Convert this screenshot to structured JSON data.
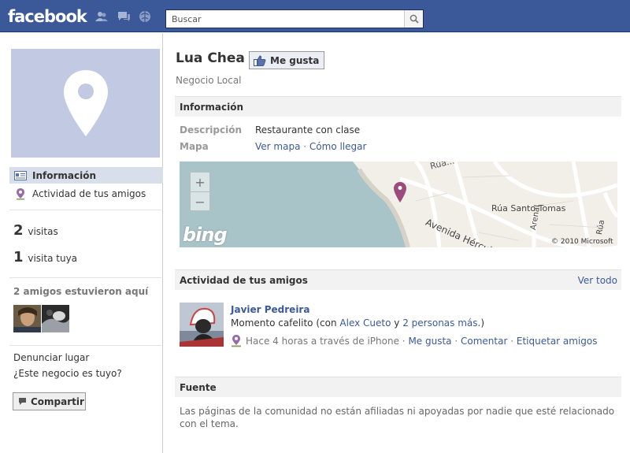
{
  "topbar": {
    "logo": "facebook",
    "search_placeholder": "Buscar",
    "jewels": [
      "friends-icon",
      "messages-icon",
      "notifications-icon"
    ]
  },
  "sidebar": {
    "nav": [
      {
        "label": "Información",
        "icon": "info-card-icon",
        "selected": true
      },
      {
        "label": "Actividad de tus amigos",
        "icon": "place-pin-icon",
        "selected": false
      }
    ],
    "stats": [
      {
        "number": "2",
        "label": "visitas"
      },
      {
        "number": "1",
        "label": "visita tuya"
      }
    ],
    "friends_title": "2 amigos estuvieron aquí",
    "links": [
      "Denunciar lugar",
      "¿Este negocio es tuyo?"
    ],
    "share_label": "Compartir"
  },
  "page": {
    "title": "Lua Chea",
    "like_label": "Me gusta",
    "category": "Negocio Local"
  },
  "info": {
    "header": "Información",
    "desc_label": "Descripción",
    "desc_value": "Restaurante con clase",
    "map_label": "Mapa",
    "map_link": "Ver mapa",
    "map_sep": "·",
    "directions_link": "Cómo llegar",
    "map_streets": [
      "Rúa...",
      "Avenida Hércules",
      "Rúa Santo Tomas",
      "Arenal",
      "Rúa"
    ],
    "map_logo": "bing",
    "map_copyright": "© 2010 Microsoft"
  },
  "activity": {
    "header": "Actividad de tus amigos",
    "see_all": "Ver todo",
    "friend_name": "Javier Pedreira",
    "status_text": "Momento cafelito",
    "with_open": "(con",
    "with_friend": "Alex Cueto",
    "and": "y",
    "others": "2 personas más.",
    "close": ")",
    "time": "Hace 4 horas a través de iPhone",
    "sep": "·",
    "like": "Me gusta",
    "comment": "Comentar",
    "tag": "Etiquetar amigos"
  },
  "source": {
    "header": "Fuente",
    "text": "Las páginas de la comunidad no están afiliadas ni apoyadas por nadie que esté relacionado con el tema."
  },
  "colors": {
    "brand": "#3b5998",
    "header_bg": "#f2f2f2",
    "profile_placeholder": "#c2c9e3",
    "map_water": "#a8c4c8"
  }
}
